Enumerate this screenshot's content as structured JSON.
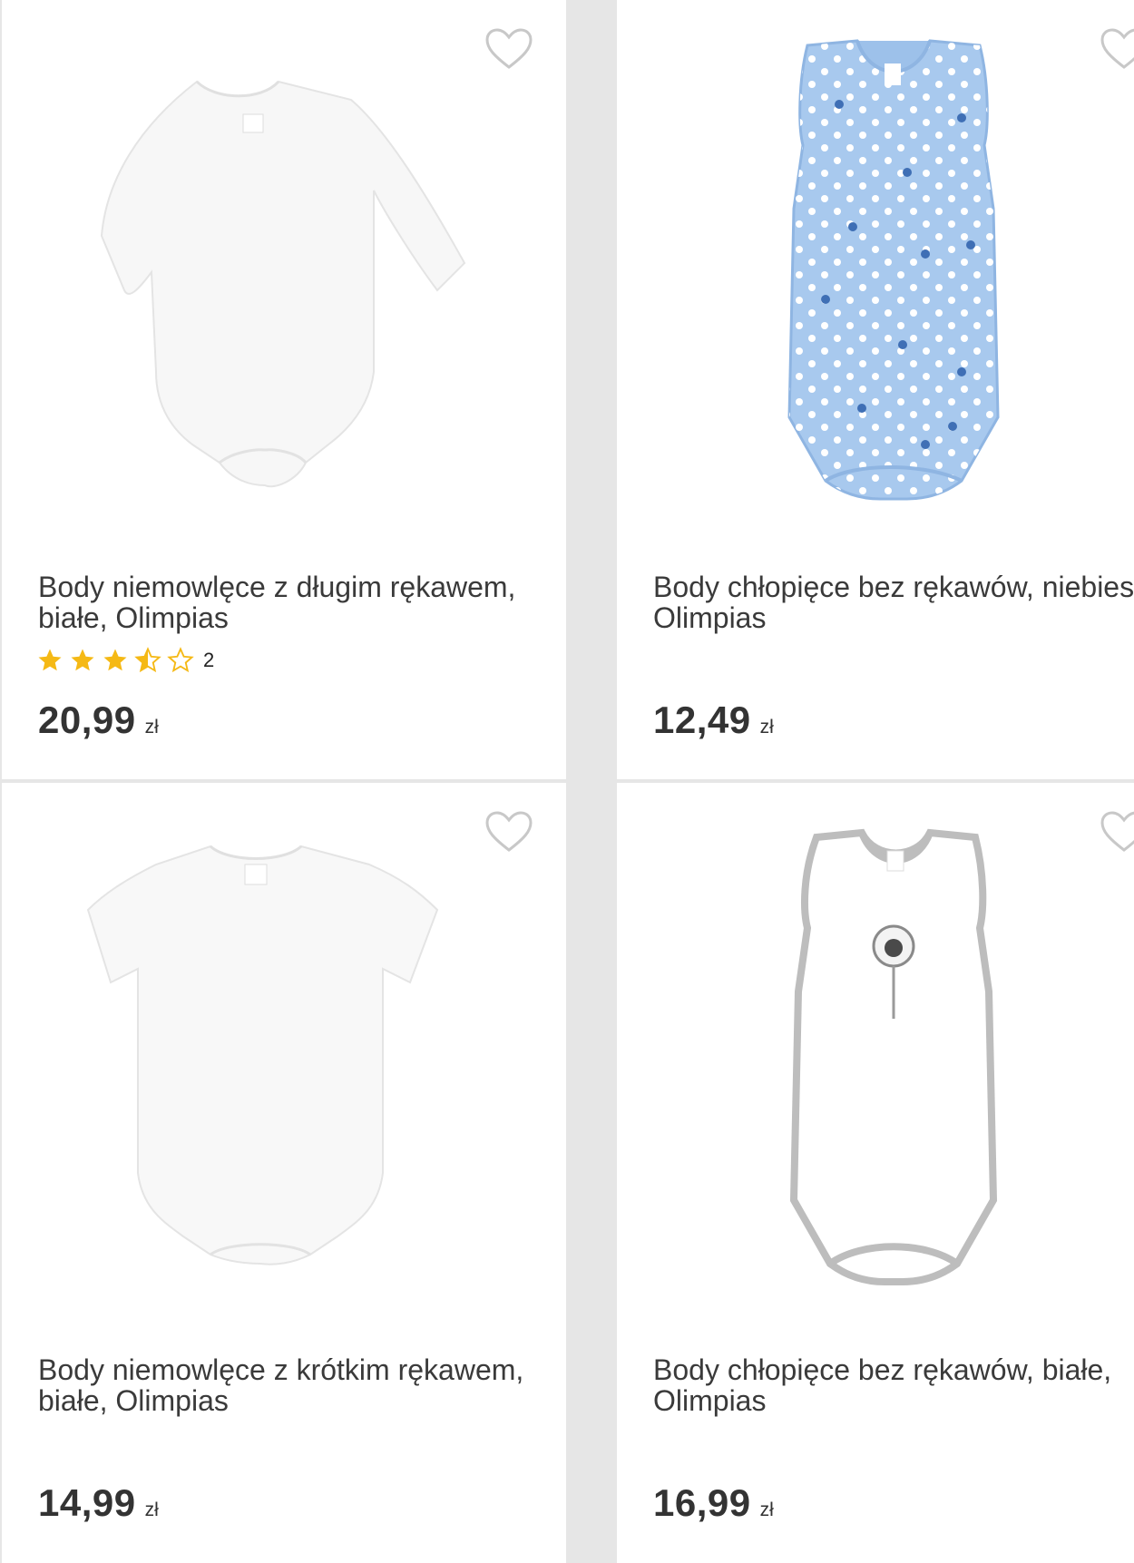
{
  "currency": "zł",
  "products": [
    {
      "name": "Body niemowlęce z długim rękawem, białe, Olimpias",
      "price": "20,99",
      "rating": 3.5,
      "rating_count": "2",
      "image_icon": "longsleeve-bodysuit-white"
    },
    {
      "name": "Body chłopięce bez rękawów, niebieskie, Olimpias",
      "price": "12,49",
      "image_icon": "sleeveless-bodysuit-blue-stars"
    },
    {
      "name": "Body niemowlęce z krótkim rękawem, białe, Olimpias",
      "price": "14,99",
      "image_icon": "shortsleeve-bodysuit-white"
    },
    {
      "name": "Body chłopięce bez rękawów, białe, Olimpias",
      "price": "16,99",
      "image_icon": "sleeveless-bodysuit-white-grey-trim"
    }
  ],
  "colors": {
    "star": "#f5b915",
    "heart": "#c8c8c8",
    "price": "#333333"
  }
}
